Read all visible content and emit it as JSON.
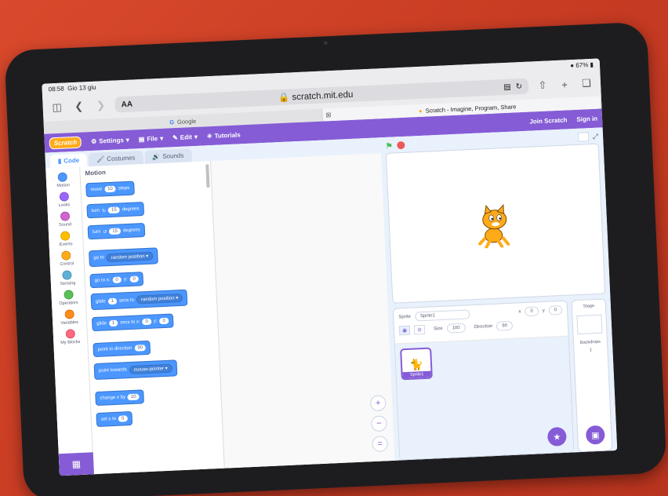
{
  "status_bar": {
    "time": "08:58",
    "date": "Gio 13 giu",
    "battery": "67%"
  },
  "safari": {
    "text_size_label": "AA",
    "url": "scratch.mit.edu",
    "tabs": [
      {
        "label": "Google",
        "active": false
      },
      {
        "label": "Scratch - Imagine, Program, Share",
        "active": true
      }
    ]
  },
  "menubar": {
    "logo": "Scratch",
    "settings": "Settings",
    "file": "File",
    "edit": "Edit",
    "tutorials": "Tutorials",
    "join": "Join Scratch",
    "signin": "Sign in"
  },
  "editor_tabs": {
    "code": "Code",
    "costumes": "Costumes",
    "sounds": "Sounds"
  },
  "categories": [
    {
      "label": "Motion",
      "color": "#4c97ff"
    },
    {
      "label": "Looks",
      "color": "#9966ff"
    },
    {
      "label": "Sound",
      "color": "#cf63cf"
    },
    {
      "label": "Events",
      "color": "#ffbf00"
    },
    {
      "label": "Control",
      "color": "#ffab19"
    },
    {
      "label": "Sensing",
      "color": "#5cb1d6"
    },
    {
      "label": "Operators",
      "color": "#59c059"
    },
    {
      "label": "Variables",
      "color": "#ff8c1a"
    },
    {
      "label": "My Blocks",
      "color": "#ff6680"
    }
  ],
  "blocks": {
    "title": "Motion",
    "move": {
      "a": "move",
      "v": "10",
      "b": "steps"
    },
    "turn_right": {
      "a": "turn",
      "v": "15",
      "b": "degrees"
    },
    "turn_left": {
      "a": "turn",
      "v": "15",
      "b": "degrees"
    },
    "goto": {
      "a": "go to",
      "dd": "random position"
    },
    "goto_xy": {
      "a": "go to x:",
      "x": "0",
      "b": "y:",
      "y": "0"
    },
    "glide_to": {
      "a": "glide",
      "v": "1",
      "b": "secs to",
      "dd": "random position"
    },
    "glide_xy": {
      "a": "glide",
      "v": "1",
      "b": "secs to x:",
      "x": "0",
      "c": "y:",
      "y": "0"
    },
    "point_dir": {
      "a": "point in direction",
      "v": "90"
    },
    "point_towards": {
      "a": "point towards",
      "dd": "mouse-pointer"
    },
    "change_x": {
      "a": "change x by",
      "v": "10"
    },
    "set_x": {
      "a": "set x to",
      "v": "0"
    }
  },
  "sprite_info": {
    "sprite_label": "Sprite",
    "sprite_name": "Sprite1",
    "x_label": "x",
    "x": "0",
    "y_label": "y",
    "y": "0",
    "size_label": "Size",
    "size": "100",
    "direction_label": "Direction",
    "direction": "90"
  },
  "sprite_thumb": {
    "name": "Sprite1"
  },
  "stage_pane": {
    "title": "Stage",
    "backdrops_label": "Backdrops",
    "backdrops_count": "1"
  }
}
